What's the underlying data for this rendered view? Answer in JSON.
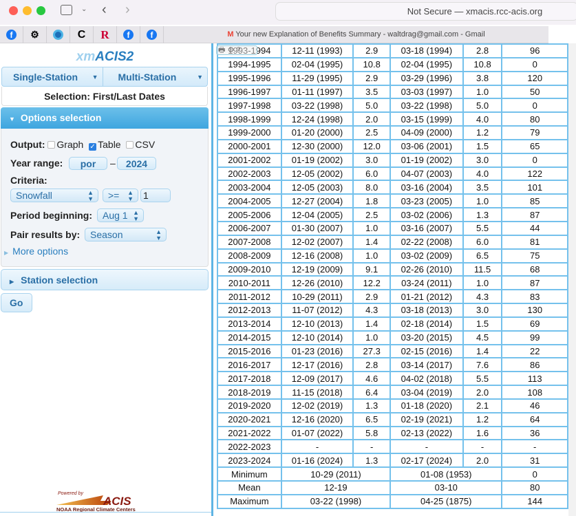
{
  "browser": {
    "address": "Not Secure — xmacis.rcc-acis.org",
    "bookmark_tab": "Your new Explanation of Benefits Summary - waltdrag@gmail.com - Gmail"
  },
  "app": {
    "logo_prefix": "xm",
    "logo_main": "ACIS2",
    "tabs": [
      {
        "label": "Single-Station"
      },
      {
        "label": "Multi-Station"
      }
    ],
    "selection": "Selection: First/Last Dates",
    "options": {
      "header": "Options selection",
      "output_label": "Output:",
      "output_options": [
        {
          "label": "Graph",
          "checked": false
        },
        {
          "label": "Table",
          "checked": true
        },
        {
          "label": "CSV",
          "checked": false
        }
      ],
      "year_range_label": "Year range:",
      "year_start": "por",
      "year_sep": "–",
      "year_end": "2024",
      "criteria_label": "Criteria:",
      "criteria_element": "Snowfall",
      "criteria_op": ">=",
      "criteria_value": "1",
      "period_label": "Period beginning:",
      "period_value": "Aug 1",
      "pair_label": "Pair results by:",
      "pair_value": "Season",
      "more_options": "More options"
    },
    "station_selection": "Station selection",
    "go": "Go",
    "powered_by": "Powered by",
    "acis_logo": "ACIS",
    "acis_sub": "NOAA Regional Climate Centers"
  },
  "table": {
    "rows": [
      [
        "1993-1994",
        "12-11 (1993)",
        "2.9",
        "03-18 (1994)",
        "2.8",
        "96"
      ],
      [
        "1994-1995",
        "02-04 (1995)",
        "10.8",
        "02-04 (1995)",
        "10.8",
        "0"
      ],
      [
        "1995-1996",
        "11-29 (1995)",
        "2.9",
        "03-29 (1996)",
        "3.8",
        "120"
      ],
      [
        "1996-1997",
        "01-11 (1997)",
        "3.5",
        "03-03 (1997)",
        "1.0",
        "50"
      ],
      [
        "1997-1998",
        "03-22 (1998)",
        "5.0",
        "03-22 (1998)",
        "5.0",
        "0"
      ],
      [
        "1998-1999",
        "12-24 (1998)",
        "2.0",
        "03-15 (1999)",
        "4.0",
        "80"
      ],
      [
        "1999-2000",
        "01-20 (2000)",
        "2.5",
        "04-09 (2000)",
        "1.2",
        "79"
      ],
      [
        "2000-2001",
        "12-30 (2000)",
        "12.0",
        "03-06 (2001)",
        "1.5",
        "65"
      ],
      [
        "2001-2002",
        "01-19 (2002)",
        "3.0",
        "01-19 (2002)",
        "3.0",
        "0"
      ],
      [
        "2002-2003",
        "12-05 (2002)",
        "6.0",
        "04-07 (2003)",
        "4.0",
        "122"
      ],
      [
        "2003-2004",
        "12-05 (2003)",
        "8.0",
        "03-16 (2004)",
        "3.5",
        "101"
      ],
      [
        "2004-2005",
        "12-27 (2004)",
        "1.8",
        "03-23 (2005)",
        "1.0",
        "85"
      ],
      [
        "2005-2006",
        "12-04 (2005)",
        "2.5",
        "03-02 (2006)",
        "1.3",
        "87"
      ],
      [
        "2006-2007",
        "01-30 (2007)",
        "1.0",
        "03-16 (2007)",
        "5.5",
        "44"
      ],
      [
        "2007-2008",
        "12-02 (2007)",
        "1.4",
        "02-22 (2008)",
        "6.0",
        "81"
      ],
      [
        "2008-2009",
        "12-16 (2008)",
        "1.0",
        "03-02 (2009)",
        "6.5",
        "75"
      ],
      [
        "2009-2010",
        "12-19 (2009)",
        "9.1",
        "02-26 (2010)",
        "11.5",
        "68"
      ],
      [
        "2010-2011",
        "12-26 (2010)",
        "12.2",
        "03-24 (2011)",
        "1.0",
        "87"
      ],
      [
        "2011-2012",
        "10-29 (2011)",
        "2.9",
        "01-21 (2012)",
        "4.3",
        "83"
      ],
      [
        "2012-2013",
        "11-07 (2012)",
        "4.3",
        "03-18 (2013)",
        "3.0",
        "130"
      ],
      [
        "2013-2014",
        "12-10 (2013)",
        "1.4",
        "02-18 (2014)",
        "1.5",
        "69"
      ],
      [
        "2014-2015",
        "12-10 (2014)",
        "1.0",
        "03-20 (2015)",
        "4.5",
        "99"
      ],
      [
        "2015-2016",
        "01-23 (2016)",
        "27.3",
        "02-15 (2016)",
        "1.4",
        "22"
      ],
      [
        "2016-2017",
        "12-17 (2016)",
        "2.8",
        "03-14 (2017)",
        "7.6",
        "86"
      ],
      [
        "2017-2018",
        "12-09 (2017)",
        "4.6",
        "04-02 (2018)",
        "5.5",
        "113"
      ],
      [
        "2018-2019",
        "11-15 (2018)",
        "6.4",
        "03-04 (2019)",
        "2.0",
        "108"
      ],
      [
        "2019-2020",
        "12-02 (2019)",
        "1.3",
        "01-18 (2020)",
        "2.1",
        "46"
      ],
      [
        "2020-2021",
        "12-16 (2020)",
        "6.5",
        "02-19 (2021)",
        "1.2",
        "64"
      ],
      [
        "2021-2022",
        "01-07 (2022)",
        "5.8",
        "02-13 (2022)",
        "1.6",
        "36"
      ],
      [
        "2022-2023",
        "-",
        "-",
        "-",
        "-",
        "-"
      ],
      [
        "2023-2024",
        "01-16 (2024)",
        "1.3",
        "02-17 (2024)",
        "2.0",
        "31"
      ]
    ],
    "summary": [
      [
        "Minimum",
        "10-29 (2011)",
        "01-08 (1953)",
        "0"
      ],
      [
        "Mean",
        "12-19",
        "03-10",
        "80"
      ],
      [
        "Maximum",
        "03-22 (1998)",
        "04-25 (1875)",
        "144"
      ]
    ]
  }
}
